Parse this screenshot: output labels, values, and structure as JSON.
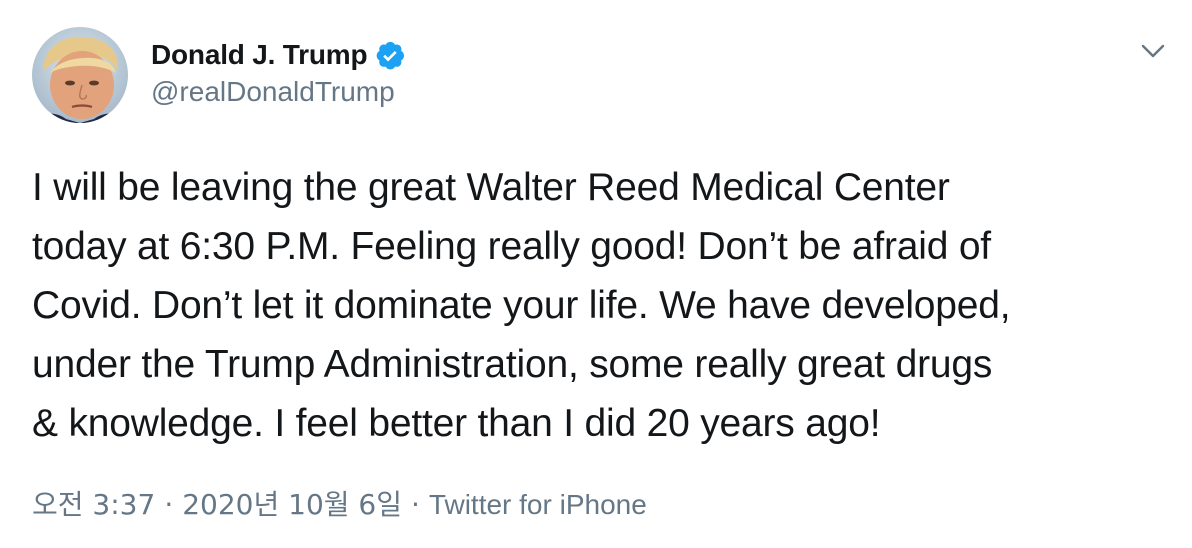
{
  "author": {
    "display_name": "Donald J. Trump",
    "handle": "@realDonaldTrump",
    "verified": true,
    "verified_color": "#1da1f2"
  },
  "menu": {
    "icon": "chevron-down-icon"
  },
  "tweet": {
    "lines": [
      "I will be leaving the great Walter Reed Medical Center",
      "today at 6:30 P.M. Feeling really good! Don’t be afraid of",
      "Covid. Don’t let it dominate your life. We have developed,",
      "under the Trump Administration, some really great drugs",
      "& knowledge. I feel better than I did 20 years ago!"
    ]
  },
  "meta": {
    "time": "오전 3:37",
    "separator": "·",
    "date": "2020년 10월 6일",
    "source": "Twitter for iPhone"
  },
  "colors": {
    "text": "#14171a",
    "secondary": "#657786",
    "accent": "#1da1f2"
  }
}
